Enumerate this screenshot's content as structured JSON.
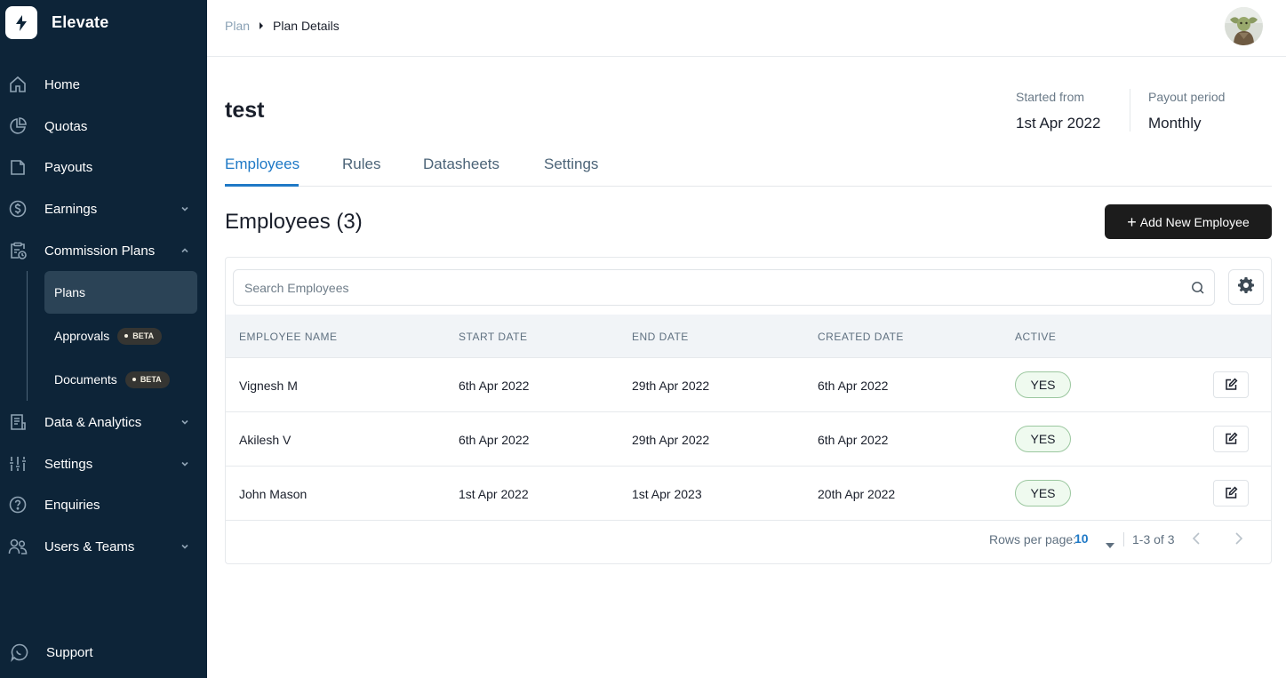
{
  "app": {
    "name": "Elevate"
  },
  "sidebar": {
    "items": [
      {
        "label": "Home",
        "icon": "home-icon"
      },
      {
        "label": "Quotas",
        "icon": "pie-chart-icon"
      },
      {
        "label": "Payouts",
        "icon": "payouts-icon"
      },
      {
        "label": "Earnings",
        "icon": "dollar-circle-icon"
      },
      {
        "label": "Commission Plans",
        "icon": "clipboard-clock-icon"
      },
      {
        "label": "Data & Analytics",
        "icon": "report-icon"
      },
      {
        "label": "Settings",
        "icon": "sliders-icon"
      },
      {
        "label": "Enquiries",
        "icon": "question-circle-icon"
      },
      {
        "label": "Users & Teams",
        "icon": "users-icon"
      }
    ],
    "sub_items": [
      {
        "label": "Plans"
      },
      {
        "label": "Approvals",
        "badge": "BETA"
      },
      {
        "label": "Documents",
        "badge": "BETA"
      }
    ],
    "support": "Support"
  },
  "breadcrumb": {
    "parent": "Plan",
    "current": "Plan Details"
  },
  "plan": {
    "title": "test",
    "started_label": "Started from",
    "started_value": "1st Apr 2022",
    "payout_label": "Payout period",
    "payout_value": "Monthly"
  },
  "tabs": [
    "Employees",
    "Rules",
    "Datasheets",
    "Settings"
  ],
  "employees": {
    "title": "Employees (3)",
    "add_button": "Add New Employee",
    "search_placeholder": "Search Employees",
    "columns": [
      "EMPLOYEE NAME",
      "START DATE",
      "END DATE",
      "CREATED DATE",
      "ACTIVE"
    ],
    "rows": [
      {
        "name": "Vignesh M",
        "start": "6th Apr 2022",
        "end": "29th Apr 2022",
        "created": "6th Apr 2022",
        "active": "YES"
      },
      {
        "name": "Akilesh V",
        "start": "6th Apr 2022",
        "end": "29th Apr 2022",
        "created": "6th Apr 2022",
        "active": "YES"
      },
      {
        "name": "John Mason",
        "start": "1st Apr 2022",
        "end": "1st Apr 2023",
        "created": "20th Apr 2022",
        "active": "YES"
      }
    ],
    "pagination": {
      "rows_per_page_label": "Rows per page:",
      "rows_per_page": "10",
      "range": "1-3 of 3"
    }
  },
  "colors": {
    "sidebar_bg": "#0d2438",
    "accent": "#1f79c6",
    "primary_button": "#1c1c1c",
    "active_badge_border": "#9bc79f"
  }
}
